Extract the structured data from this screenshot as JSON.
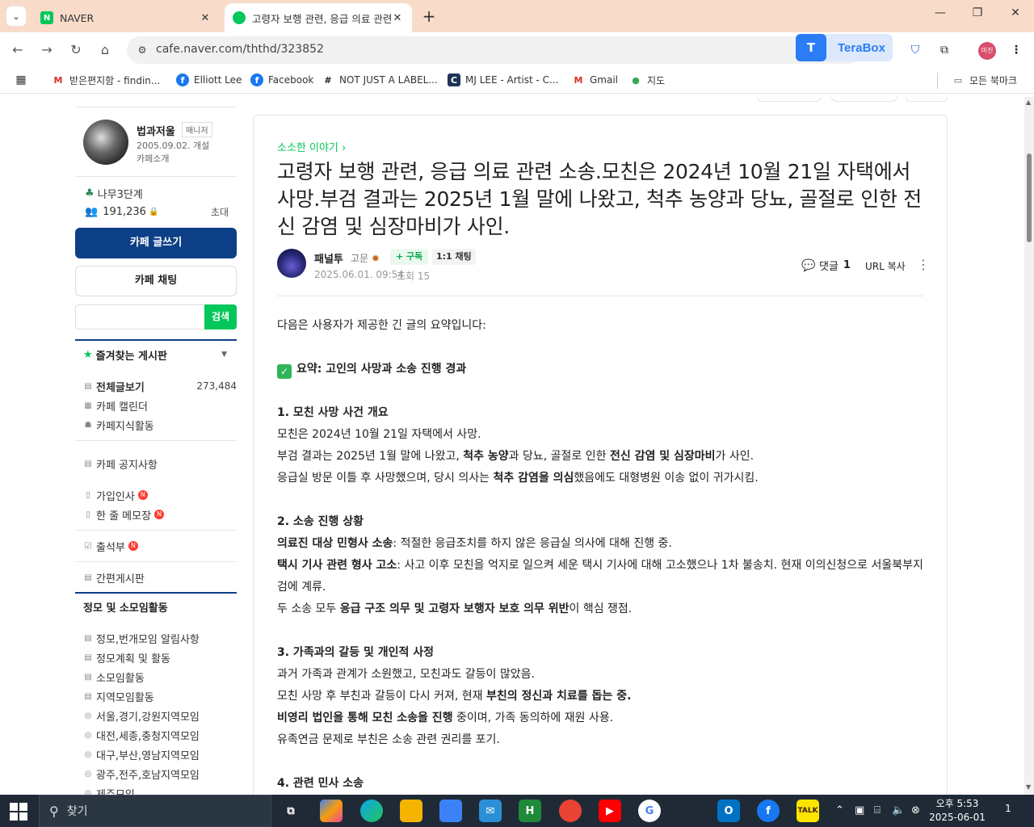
{
  "browser": {
    "tabs": [
      {
        "label": "NAVER",
        "favicon": "naver-icon",
        "active": false
      },
      {
        "label": "고령자 보행 관련, 응급 의료 관련 소송.모친은",
        "favicon": "naver-cafe-icon",
        "active": true
      }
    ],
    "url": "cafe.naver.com/ththd/323852",
    "terabox_label": "TeraBox",
    "profile_initials": "미진",
    "bookmarks": [
      {
        "label": "받은편지함 - findin...",
        "icon": "gmail-icon"
      },
      {
        "label": "Elliott Lee",
        "icon": "facebook-icon"
      },
      {
        "label": "Facebook",
        "icon": "facebook-icon"
      },
      {
        "label": "NOT JUST A LABEL...",
        "icon": "njal-icon"
      },
      {
        "label": "MJ LEE - Artist - C...",
        "icon": "saatchi-icon"
      },
      {
        "label": "Gmail",
        "icon": "gmail-icon"
      },
      {
        "label": "지도",
        "icon": "maps-icon"
      }
    ],
    "all_bookmarks": "모든 북마크"
  },
  "sidebar": {
    "manager": {
      "name": "법과저울",
      "badge": "매니저",
      "since": "2005.09.02. 개설",
      "intro": "카페소개"
    },
    "level": "나무3단계",
    "members": "191,236",
    "invite": "초대",
    "write_button": "카페 글쓰기",
    "chat_button": "카페 채팅",
    "search_button": "검색",
    "favorites_header": "즐겨찾는 게시판",
    "menu": [
      {
        "label": "전체글보기",
        "count": "273,484"
      },
      {
        "label": "카페 캘린더"
      },
      {
        "label": "카페지식활동"
      },
      {
        "label": "카페 공지사항"
      },
      {
        "label": "가입인사",
        "new": "N"
      },
      {
        "label": "한 줄 메모장",
        "new": "N"
      },
      {
        "label": "출석부",
        "new": "N"
      },
      {
        "label": "간편게시판"
      }
    ],
    "section_header": "정모 및 소모임활동",
    "section_items": [
      "정모,번개모임 알림사항",
      "정모계획 및 활동",
      "소모임활동",
      "지역모임활동",
      "서울,경기,강원지역모임",
      "대전,세종,충청지역모임",
      "대구,부산,영남지역모임",
      "광주,전주,호남지역모임",
      "제주모임"
    ]
  },
  "article": {
    "board": "소소한 이야기",
    "title": "고령자 보행 관련, 응급 의료 관련 소송.모친은 2024년 10월 21일 자택에서 사망.부검 결과는 2025년 1월 말에 나왔고, 척추 농양과 당뇨, 골절로 인한 전신 감염 및 심장마비가 사인.",
    "author": "패널투",
    "grade": "고문",
    "subscribe": "+ 구독",
    "chat11": "1:1 채팅",
    "date": "2025.06.01. 09:54",
    "views": "조회 15",
    "comment_label": "댓글",
    "comment_count": "1",
    "url_copy": "URL 복사",
    "intro": "다음은 사용자가 제공한 긴 글의 요약입니다:",
    "summary_title": "요약: 고인의 사망과 소송 진행 경과",
    "s1_title": "1. 모친 사망 사건 개요",
    "s1_l1": "모친은 2024년 10월 21일 자택에서 사망.",
    "s1_l2a": "부검 결과는 2025년 1월 말에 나왔고, ",
    "s1_l2b": "척추 농양",
    "s1_l2c": "과 당뇨, 골절로 인한 ",
    "s1_l2d": "전신 감염 및 심장마비",
    "s1_l2e": "가 사인.",
    "s1_l3a": "응급실 방문 이틀 후 사망했으며, 당시 의사는 ",
    "s1_l3b": "척추 감염을 의심",
    "s1_l3c": "했음에도 대형병원 이송 없이 귀가시킴.",
    "s2_title": "2. 소송 진행 상황",
    "s2_l1a": "의료진 대상 민형사 소송",
    "s2_l1b": ": 적절한 응급조치를 하지 않은 응급실 의사에 대해 진행 중.",
    "s2_l2a": "택시 기사 관련 형사 고소",
    "s2_l2b": ": 사고 이후 모친을 억지로 일으켜 세운 택시 기사에 대해 고소했으나 1차 불송치. 현재 이의신청으로 서울북부지검에 계류.",
    "s2_l3a": "두 소송 모두 ",
    "s2_l3b": "응급 구조 의무 및 고령자 보행자 보호 의무 위반",
    "s2_l3c": "이 핵심 쟁점.",
    "s3_title": "3. 가족과의 갈등 및 개인적 사정",
    "s3_l1": "과거 가족과 관계가 소원했고, 모친과도 갈등이 많았음.",
    "s3_l2a": "모친 사망 후 부친과 갈등이 다시 커져, 현재 ",
    "s3_l2b": "부친의 정신과 치료를 돕는 중.",
    "s3_l3a": "비영리 법인을 통해 모친 소송을 진행",
    "s3_l3b": " 중이며, 가족 동의하에 재원 사용.",
    "s3_l4": "유족연금 문제로 부친은 소송 관련 권리를 포기.",
    "s4_title": "4. 관련 민사 소송"
  },
  "taskbar": {
    "search_label": "찾기",
    "clock_time": "오후 5:53",
    "clock_date": "2025-06-01",
    "notif_count": "1"
  }
}
